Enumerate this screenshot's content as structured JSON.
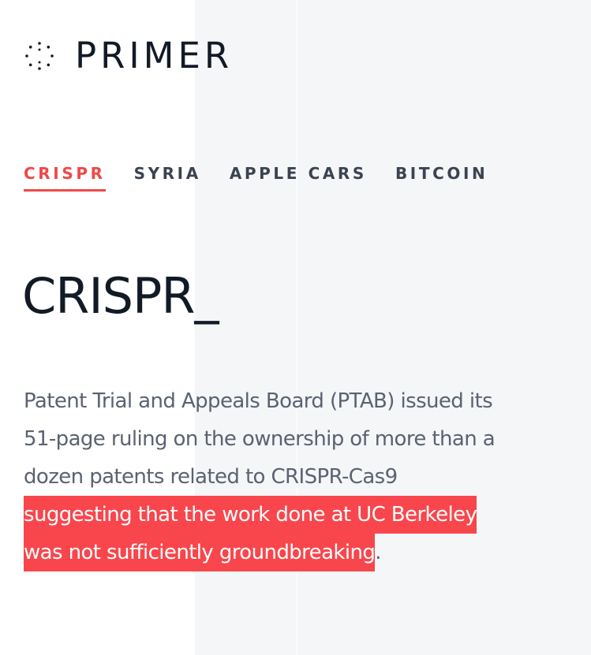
{
  "logo": {
    "icon": "dotted-circle-icon",
    "text": "PRIMER"
  },
  "tabs": [
    {
      "label": "CRISPR",
      "active": true
    },
    {
      "label": "SYRIA",
      "active": false
    },
    {
      "label": "APPLE CARS",
      "active": false
    },
    {
      "label": "BITCOIN",
      "active": false
    }
  ],
  "heading": "CRISPR_",
  "paragraph": {
    "line1": "Patent Trial and Appeals Board (PTAB) issued its",
    "line2": "51-page ruling on the ownership of more than a",
    "line3": "dozen patents related to CRISPR-Cas9",
    "line4_highlight": "suggesting that the work done at UC Berkeley",
    "line5_highlight": "was not sufficiently groundbreaking",
    "line5_tail": "."
  },
  "colors": {
    "accent": "#f04848",
    "highlight": "#f8464c",
    "text_dark": "#121a26",
    "text_body": "#5b6270",
    "panel_bg": "#f4f6f8"
  }
}
